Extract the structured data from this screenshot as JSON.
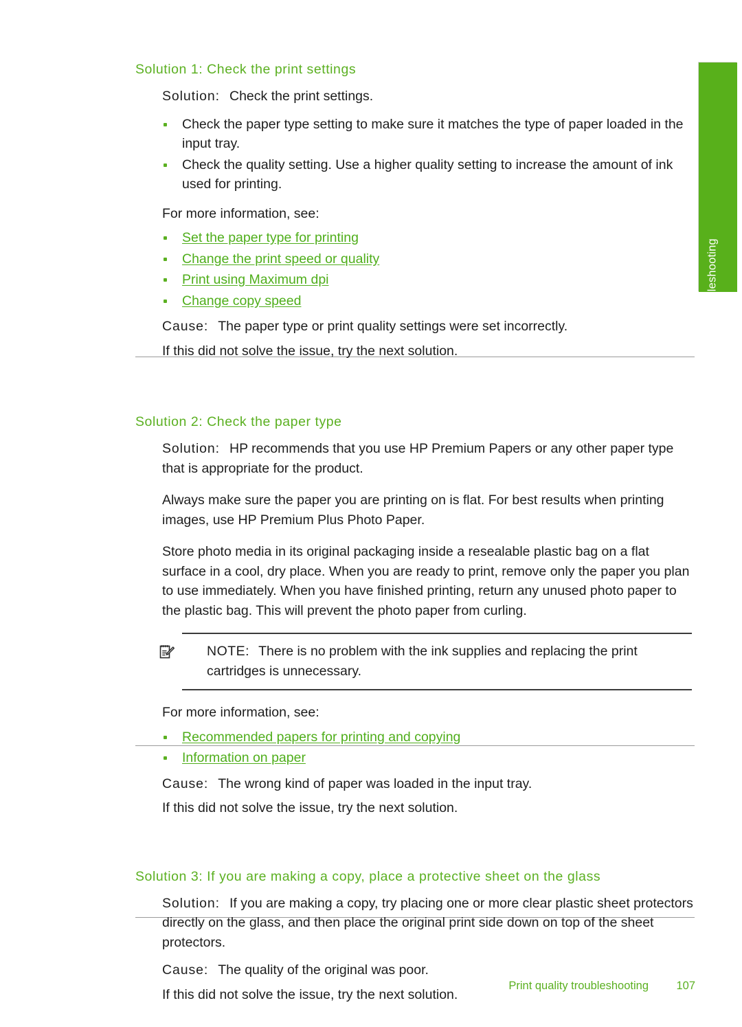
{
  "side_tab": {
    "label": "Troubleshooting",
    "color": "#58b01b"
  },
  "colors": {
    "heading_green": "#5bb021",
    "link_green": "#4fae1b",
    "body_black": "#1d1d1d",
    "rule_gray": "#9a9a9a"
  },
  "sections": [
    {
      "heading": "Solution 1: Check the print settings",
      "solution_label": "Solution:",
      "solution_text": "Check the print settings.",
      "bullets": [
        "Check the paper type setting to make sure it matches the type of paper loaded in the input tray.",
        "Check the quality setting. Use a higher quality setting to increase the amount of ink used for printing."
      ],
      "more_info_label": "For more information, see:",
      "links": [
        "Set the paper type for printing",
        "Change the print speed or quality",
        "Print using Maximum dpi",
        "Change copy speed"
      ],
      "cause_label": "Cause:",
      "cause_text": "The paper type or print quality settings were set incorrectly.",
      "next_text": "If this did not solve the issue, try the next solution."
    },
    {
      "heading": "Solution 2: Check the paper type",
      "solution_label": "Solution:",
      "solution_text": "HP recommends that you use HP Premium Papers or any other paper type that is appropriate for the product.",
      "paragraphs": [
        "Always make sure the paper you are printing on is flat. For best results when printing images, use HP Premium Plus Photo Paper.",
        "Store photo media in its original packaging inside a resealable plastic bag on a flat surface in a cool, dry place. When you are ready to print, remove only the paper you plan to use immediately. When you have finished printing, return any unused photo paper to the plastic bag. This will prevent the photo paper from curling."
      ],
      "note": {
        "icon": "note-pad-pencil-icon",
        "label": "NOTE:",
        "text": "There is no problem with the ink supplies and replacing the print cartridges is unnecessary."
      },
      "more_info_label": "For more information, see:",
      "links": [
        "Recommended papers for printing and copying",
        "Information on paper"
      ],
      "cause_label": "Cause:",
      "cause_text": "The wrong kind of paper was loaded in the input tray.",
      "next_text": "If this did not solve the issue, try the next solution."
    },
    {
      "heading": "Solution 3: If you are making a copy, place a protective sheet on the glass",
      "solution_label": "Solution:",
      "solution_text": "If you are making a copy, try placing one or more clear plastic sheet protectors directly on the glass, and then place the original print side down on top of the sheet protectors.",
      "cause_label": "Cause:",
      "cause_text": "The quality of the original was poor.",
      "next_text": "If this did not solve the issue, try the next solution."
    }
  ],
  "footer": {
    "title": "Print quality troubleshooting",
    "page_number": "107"
  }
}
